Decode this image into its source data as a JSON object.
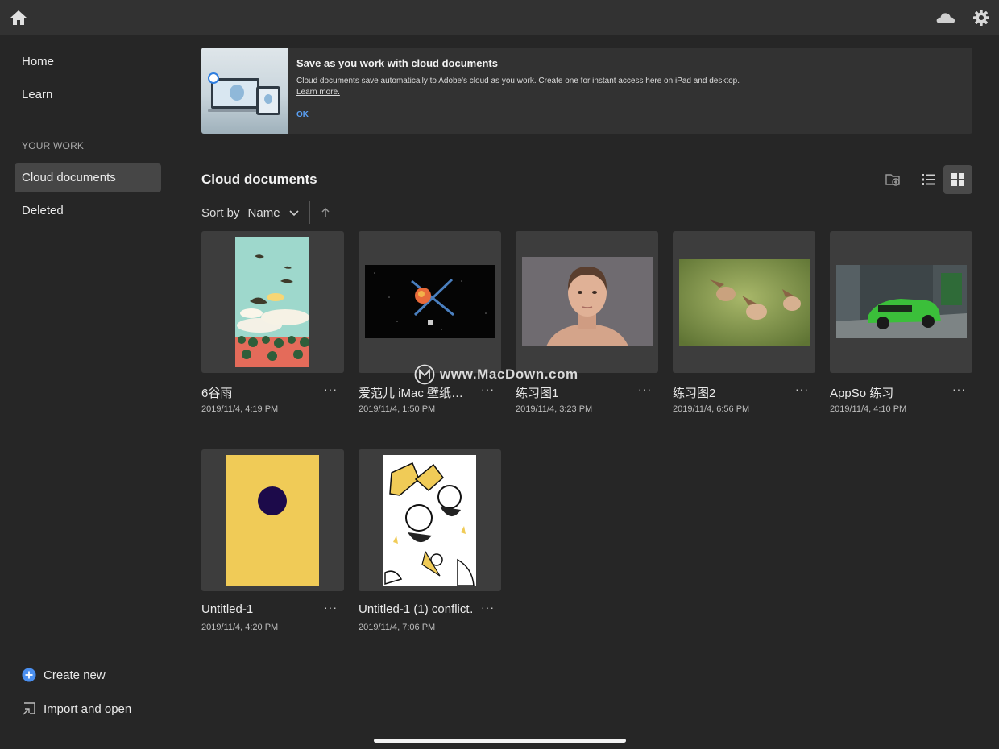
{
  "sidebar": {
    "home": "Home",
    "learn": "Learn",
    "section": "YOUR WORK",
    "cloud_documents": "Cloud documents",
    "deleted": "Deleted",
    "create_new": "Create new",
    "import_open": "Import and open"
  },
  "banner": {
    "title": "Save as you work with cloud documents",
    "body": "Cloud documents save automatically to Adobe's cloud as you work. Create one for instant access here on iPad and desktop.",
    "link": "Learn more.",
    "ok": "OK"
  },
  "main": {
    "title": "Cloud documents",
    "sort_label": "Sort by",
    "sort_value": "Name"
  },
  "documents": [
    {
      "name": "6谷雨",
      "date": "2019/11/4, 4:19 PM"
    },
    {
      "name": "爱范儿 iMac 壁纸…",
      "date": "2019/11/4, 1:50 PM"
    },
    {
      "name": "练习图1",
      "date": "2019/11/4, 3:23 PM"
    },
    {
      "name": "练习图2",
      "date": "2019/11/4, 6:56 PM"
    },
    {
      "name": "AppSo 练习",
      "date": "2019/11/4, 4:10 PM"
    },
    {
      "name": "Untitled-1",
      "date": "2019/11/4, 4:20 PM"
    },
    {
      "name": "Untitled-1 (1) conflict…",
      "date": "2019/11/4, 7:06 PM"
    }
  ],
  "more_label": "···",
  "watermark": "www.MacDown.com",
  "icons": {
    "home": "home-icon",
    "cloud": "cloud-icon",
    "settings": "gear-icon",
    "new_folder": "folder-add-icon",
    "list_view": "list-view-icon",
    "grid_view": "grid-view-icon",
    "create": "plus-circle-icon",
    "import": "import-icon"
  },
  "colors": {
    "accent": "#5aa0f5",
    "background": "#262626",
    "topbar": "#323232",
    "active_nav": "#464646"
  }
}
